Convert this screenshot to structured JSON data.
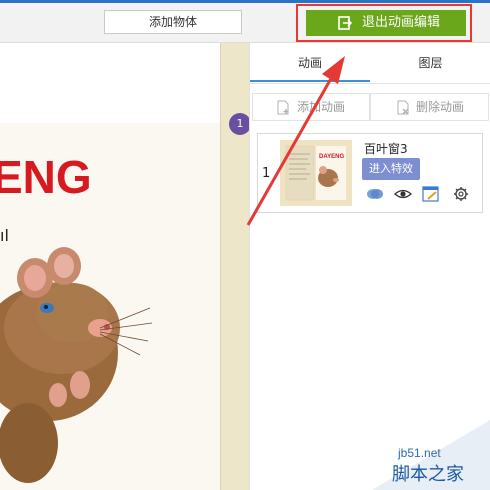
{
  "toolbar": {
    "add_object_label": "添加物体",
    "exit_edit_label": "退出动画编辑"
  },
  "canvas": {
    "page_badge": "1",
    "book_title_partial": "ENG",
    "book_text_partial": "ıl"
  },
  "panel": {
    "tabs": [
      {
        "label": "动画",
        "active": true
      },
      {
        "label": "图层",
        "active": false
      }
    ],
    "actions": {
      "add_label": "添加动画",
      "delete_label": "删除动画"
    },
    "animation_items": [
      {
        "index": "1",
        "name": "百叶窗3",
        "effect_label": "进入特效",
        "thumb_title": "DAYENG"
      }
    ]
  },
  "watermark": {
    "url": "jb51.net",
    "text": "脚本之家"
  },
  "colors": {
    "exit_button": "#6aa71b",
    "highlight_frame": "#e53935",
    "tab_accent": "#3d8fd8",
    "page_strip": "#ede6c8",
    "badge": "#6a4fa0",
    "effect_button": "#7d8fd1"
  }
}
